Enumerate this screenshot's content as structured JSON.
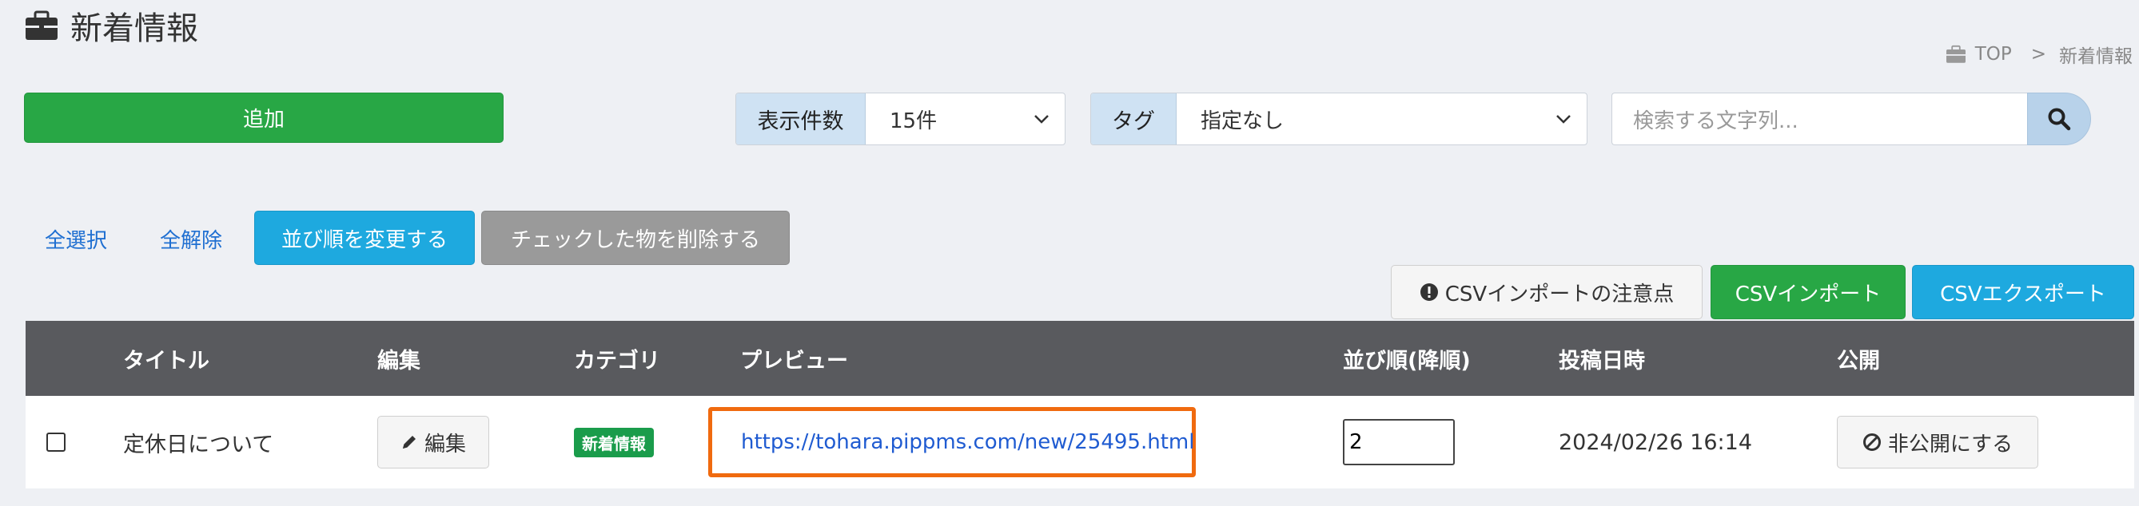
{
  "header": {
    "title": "新着情報",
    "breadcrumb": [
      {
        "label": "TOP"
      },
      {
        "label": "新着情報"
      }
    ],
    "breadcrumb_sep": ">"
  },
  "toolbar": {
    "add_label": "追加",
    "count": {
      "label": "表示件数",
      "value": "15件"
    },
    "tag": {
      "label": "タグ",
      "value": "指定なし"
    },
    "search": {
      "placeholder": "検索する文字列..."
    }
  },
  "actions": {
    "select_all": "全選択",
    "deselect_all": "全解除",
    "sort": "並び順を変更する",
    "delete_checked": "チェックした物を削除する",
    "csv_note": "CSVインポートの注意点",
    "csv_import": "CSVインポート",
    "csv_export": "CSVエクスポート"
  },
  "table": {
    "columns": [
      "タイトル",
      "編集",
      "カテゴリ",
      "プレビュー",
      "並び順(降順)",
      "投稿日時",
      "公開"
    ],
    "rows": [
      {
        "checked": false,
        "title": "定休日について",
        "edit_label": "編集",
        "category": "新着情報",
        "preview_url": "https://tohara.pippms.com/new/25495.html",
        "order": "2",
        "posted_at": "2024/02/26 16:14",
        "publish_label": "非公開にする"
      }
    ]
  },
  "colors": {
    "add": "#28a745",
    "info": "#1ea9df",
    "gray": "#9a9a9a",
    "header_bg": "#595a5e",
    "badge": "#1a9c4b",
    "highlight": "#f06a0f",
    "link": "#1f5bd1"
  },
  "icons": {
    "title": "briefcase-icon",
    "breadcrumb": "briefcase-icon",
    "search": "search-icon",
    "csv_note": "exclamation-circle-icon",
    "edit": "pencil-icon",
    "unpublish": "ban-icon"
  }
}
